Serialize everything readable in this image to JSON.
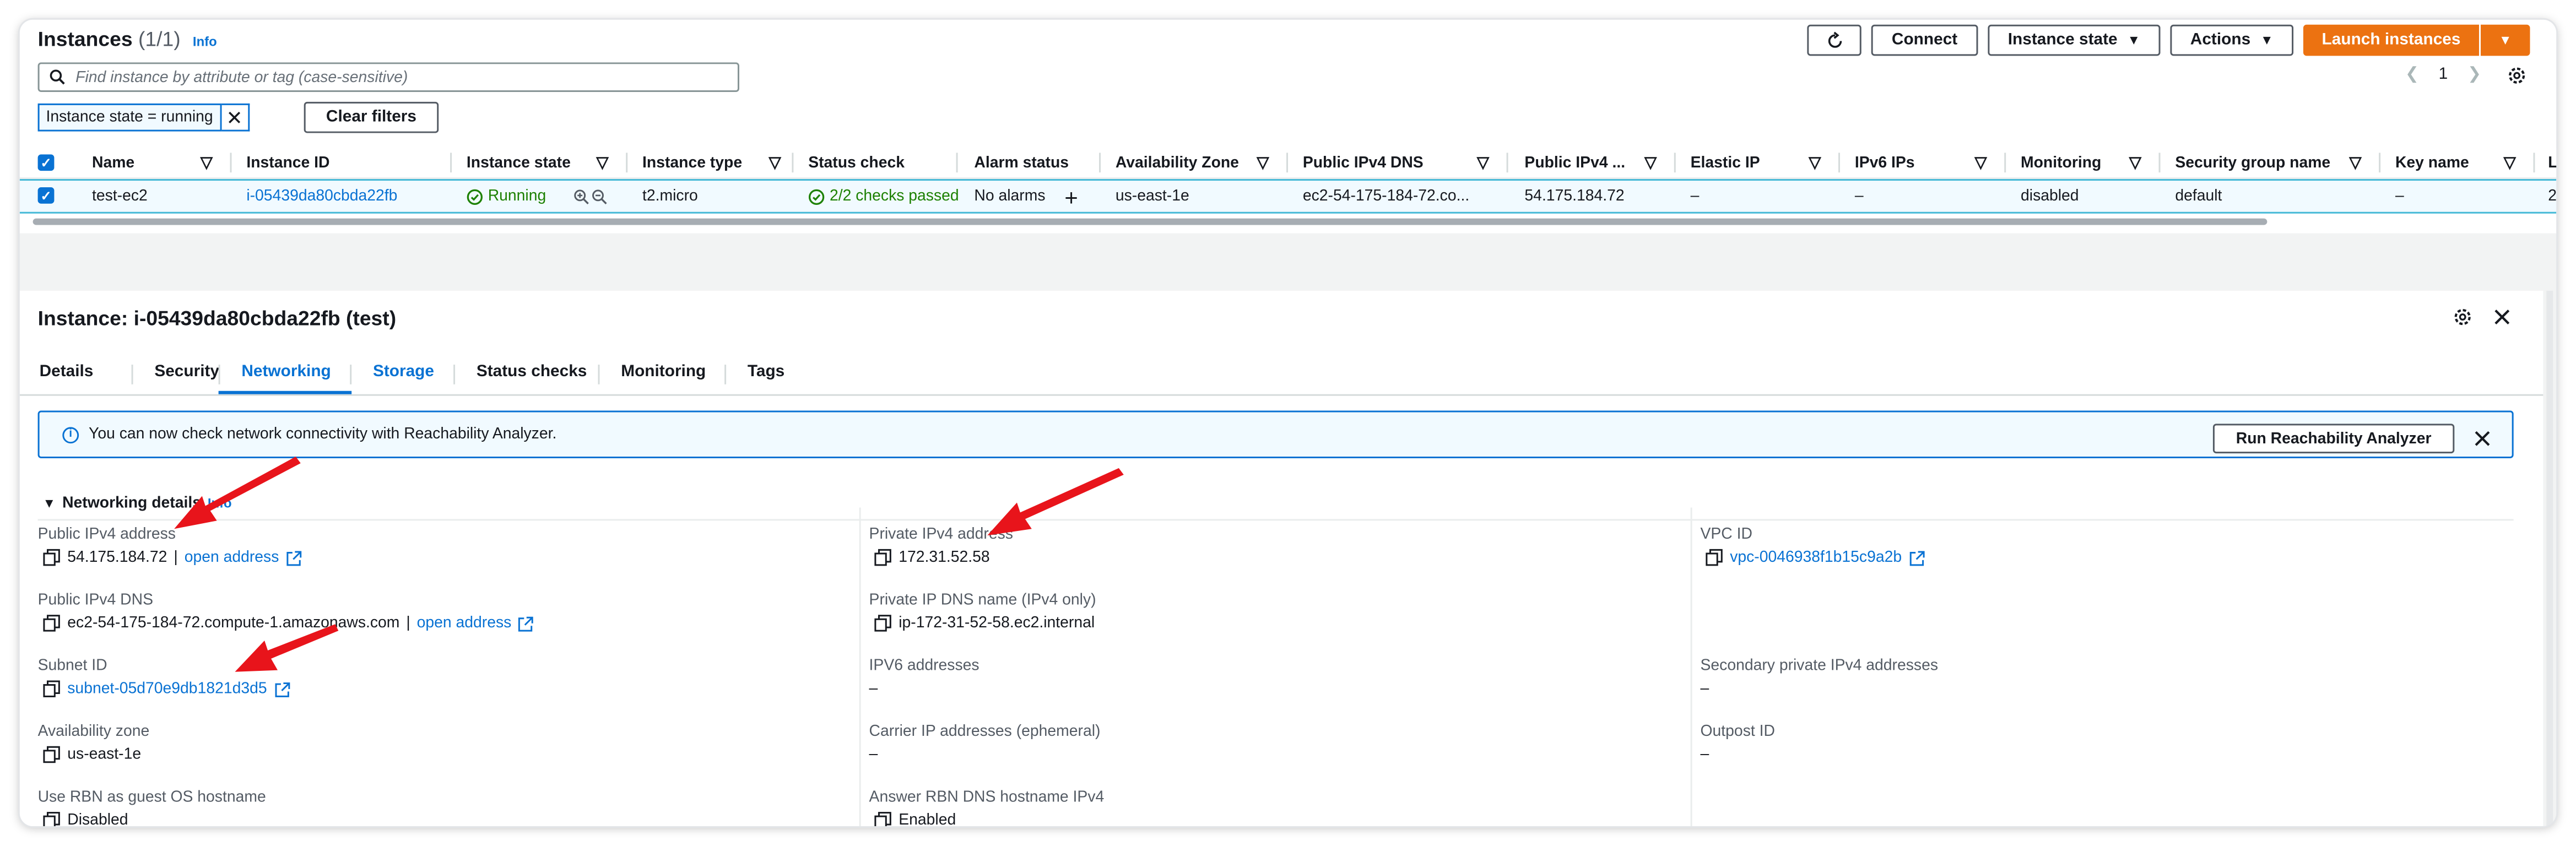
{
  "header": {
    "title": "Instances",
    "count": "(1/1)",
    "info": "Info",
    "refresh_icon": "refresh-icon",
    "connect_label": "Connect",
    "instance_state_label": "Instance state",
    "actions_label": "Actions",
    "launch_label": "Launch instances"
  },
  "search": {
    "placeholder": "Find instance by attribute or tag (case-sensitive)",
    "filter_token": "Instance state = running",
    "clear_filters": "Clear filters"
  },
  "pagination": {
    "page": "1"
  },
  "table": {
    "columns": [
      "Name",
      "Instance ID",
      "Instance state",
      "Instance type",
      "Status check",
      "Alarm status",
      "Availability Zone",
      "Public IPv4 DNS",
      "Public IPv4 ...",
      "Elastic IP",
      "IPv6 IPs",
      "Monitoring",
      "Security group name",
      "Key name",
      "L"
    ],
    "row": {
      "name": "test-ec2",
      "instance_id": "i-05439da80cbda22fb",
      "state": "Running",
      "type": "t2.micro",
      "status_check": "2/2 checks passed",
      "alarm_status": "No alarms",
      "az": "us-east-1e",
      "public_dns": "ec2-54-175-184-72.co...",
      "public_ip": "54.175.184.72",
      "elastic_ip": "–",
      "ipv6": "–",
      "monitoring": "disabled",
      "security_group": "default",
      "key_name": "–",
      "launch": "2"
    }
  },
  "detail": {
    "title": "Instance: i-05439da80cbda22fb (test)",
    "tabs": [
      "Details",
      "Security",
      "Networking",
      "Storage",
      "Status checks",
      "Monitoring",
      "Tags"
    ],
    "active_tab": "Networking",
    "flash_text": "You can now check network connectivity with Reachability Analyzer.",
    "flash_button": "Run Reachability Analyzer",
    "section_title": "Networking details",
    "section_info": "Info",
    "open_address": "open address",
    "fields": {
      "public_ipv4_label": "Public IPv4 address",
      "public_ipv4_value": "54.175.184.72",
      "private_ipv4_label": "Private IPv4 address",
      "private_ipv4_value": "172.31.52.58",
      "vpc_label": "VPC ID",
      "vpc_value": "vpc-0046938f1b15c9a2b",
      "public_dns_label": "Public IPv4 DNS",
      "public_dns_value": "ec2-54-175-184-72.compute-1.amazonaws.com",
      "private_dns_label": "Private IP DNS name (IPv4 only)",
      "private_dns_value": "ip-172-31-52-58.ec2.internal",
      "subnet_label": "Subnet ID",
      "subnet_value": "subnet-05d70e9db1821d3d5",
      "ipv6_label": "IPV6 addresses",
      "ipv6_value": "–",
      "secondary_label": "Secondary private IPv4 addresses",
      "secondary_value": "–",
      "az_label": "Availability zone",
      "az_value": "us-east-1e",
      "carrier_label": "Carrier IP addresses (ephemeral)",
      "carrier_value": "–",
      "outpost_label": "Outpost ID",
      "outpost_value": "–",
      "rbn_label": "Use RBN as guest OS hostname",
      "rbn_value": "Disabled",
      "answer_rbn_label": "Answer RBN DNS hostname IPv4",
      "answer_rbn_value": "Enabled"
    }
  },
  "colors": {
    "accent": "#0972d3",
    "primary_button": "#ec7211",
    "success": "#1d8102",
    "annotation_arrow": "#e8141b"
  }
}
